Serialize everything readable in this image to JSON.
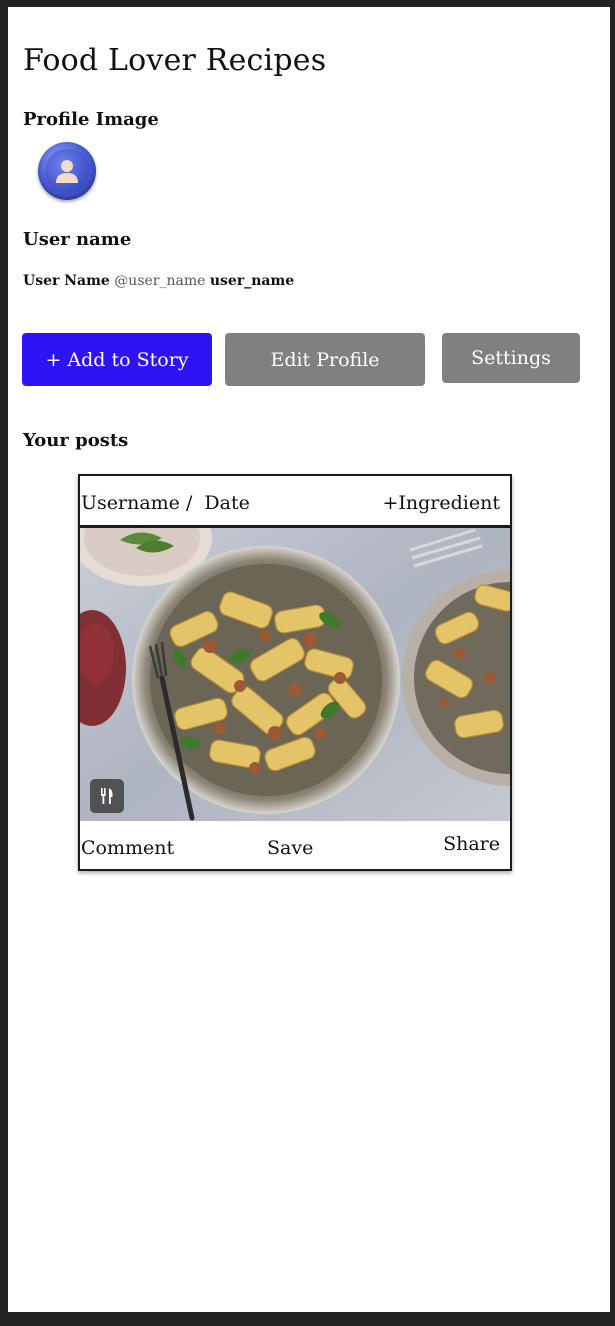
{
  "app": {
    "title": "Food Lover Recipes"
  },
  "profile": {
    "image_label": "Profile Image",
    "username_label": "User name",
    "display_name": "User Name",
    "handle": "@user_name",
    "username": "user_name"
  },
  "actions": {
    "add_story": "+ Add to Story",
    "edit_profile": "Edit Profile",
    "settings": "Settings"
  },
  "posts": {
    "section_label": "Your posts",
    "items": [
      {
        "meta": "Username /  Date",
        "ingredient": "+Ingredient",
        "image_icon": "utensils-icon",
        "comment": "Comment",
        "save": "Save",
        "share": "Share"
      }
    ]
  },
  "colors": {
    "primary": "#2d14f5",
    "secondary_button": "#808080",
    "background_outer": "#232323",
    "card_border": "#1a1a1a"
  }
}
